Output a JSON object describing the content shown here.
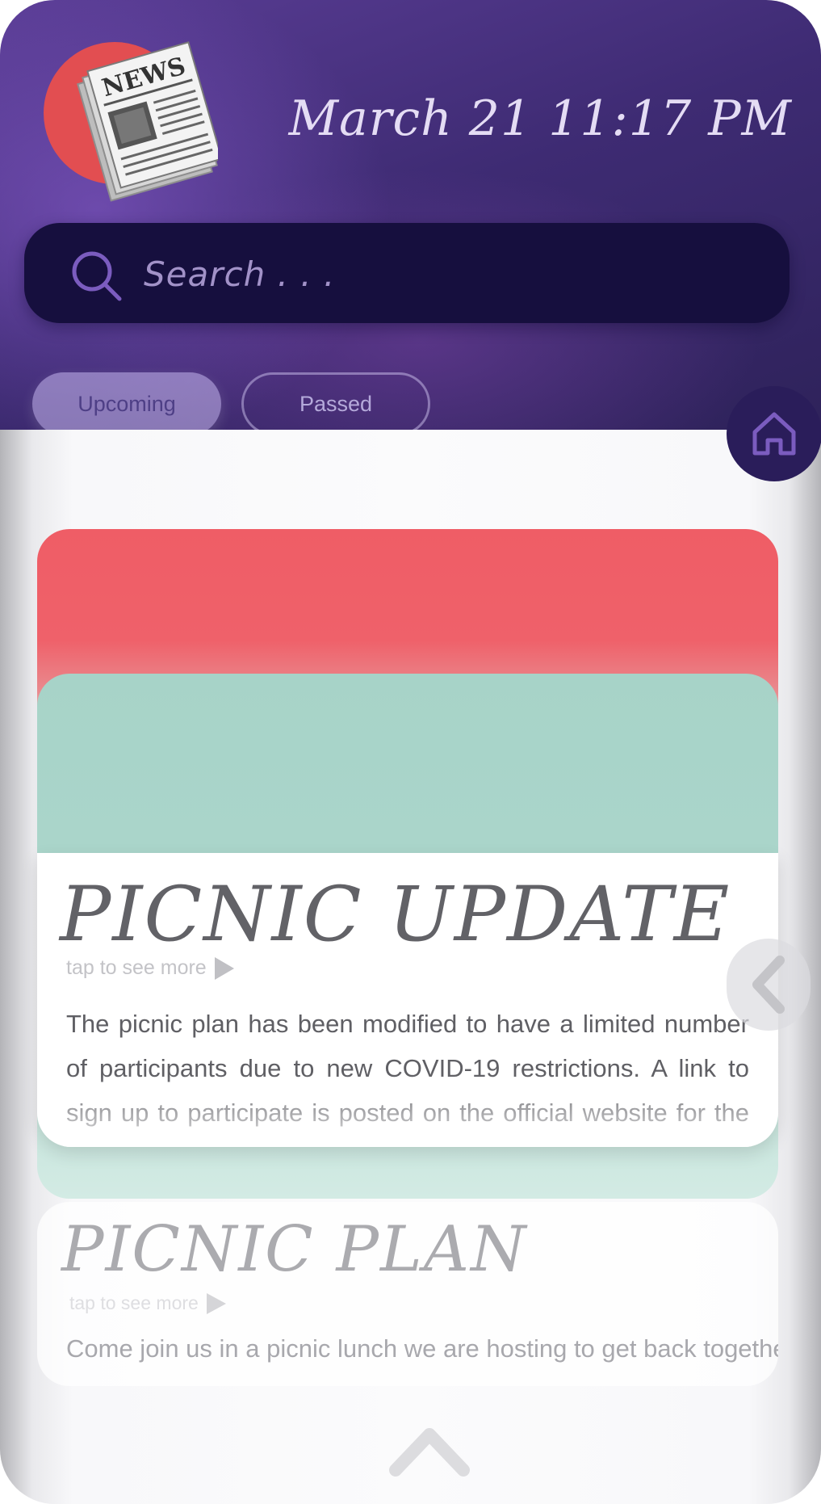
{
  "header": {
    "logo_text": "NEWS",
    "datetime": "March 21 11:17 PM"
  },
  "search": {
    "placeholder": "Search . . ."
  },
  "tabs": [
    {
      "label": "Upcoming",
      "active": true
    },
    {
      "label": "Passed",
      "active": false
    }
  ],
  "icons": {
    "home": "home-icon",
    "search": "search-icon",
    "side_nav": "chevron-left-icon",
    "bottom_nav": "chevron-up-icon"
  },
  "cards": {
    "featured": {
      "title": "PICNIC UPDATE",
      "tap_hint": "tap to see more",
      "body": "The picnic plan has been modified to have a limited number of participants due to new COVID-19 restrictions. A link to sign up to participate is posted on the official website for the church and s-"
    },
    "next": {
      "title": "PICNIC PLAN",
      "tap_hint": "tap to see more",
      "body": "Come join us in a picnic lunch we are hosting to get back together"
    }
  },
  "colors": {
    "header_purple": "#3e2b73",
    "search_bg": "#160f3e",
    "card_red": "#ef5d66",
    "card_teal": "#a7d3c8",
    "title_gray": "#626267"
  }
}
